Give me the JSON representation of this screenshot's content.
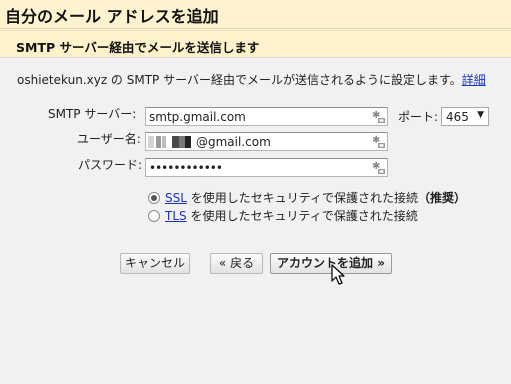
{
  "dialog": {
    "title": "自分のメール アドレスを追加",
    "section_title": "SMTP サーバー経由でメールを送信します",
    "description": "oshietekun.xyz の SMTP サーバー経由でメールが送信されるように設定します。",
    "details_link": "詳細"
  },
  "form": {
    "smtp_label": "SMTP サーバー:",
    "smtp_value": "smtp.gmail.com",
    "port_label": "ポート:",
    "port_value": "465",
    "username_label": "ユーザー名:",
    "username_value": "@gmail.com",
    "password_label": "パスワード:",
    "password_value": "••••••••••••"
  },
  "security": {
    "ssl_link": "SSL",
    "ssl_text": " を使用したセキュリティで保護された接続",
    "ssl_recommended": "（推奨）",
    "ssl_checked": true,
    "tls_link": "TLS",
    "tls_text": " を使用したセキュリティで保護された接続",
    "tls_checked": false
  },
  "buttons": {
    "cancel": "キャンセル",
    "back": "« 戻る",
    "add_account": "アカウントを追加 »"
  },
  "icons": {
    "password_manager": "key-asterisk-icon",
    "dropdown": "triangle-down-icon",
    "cursor": "mouse-pointer-icon"
  }
}
